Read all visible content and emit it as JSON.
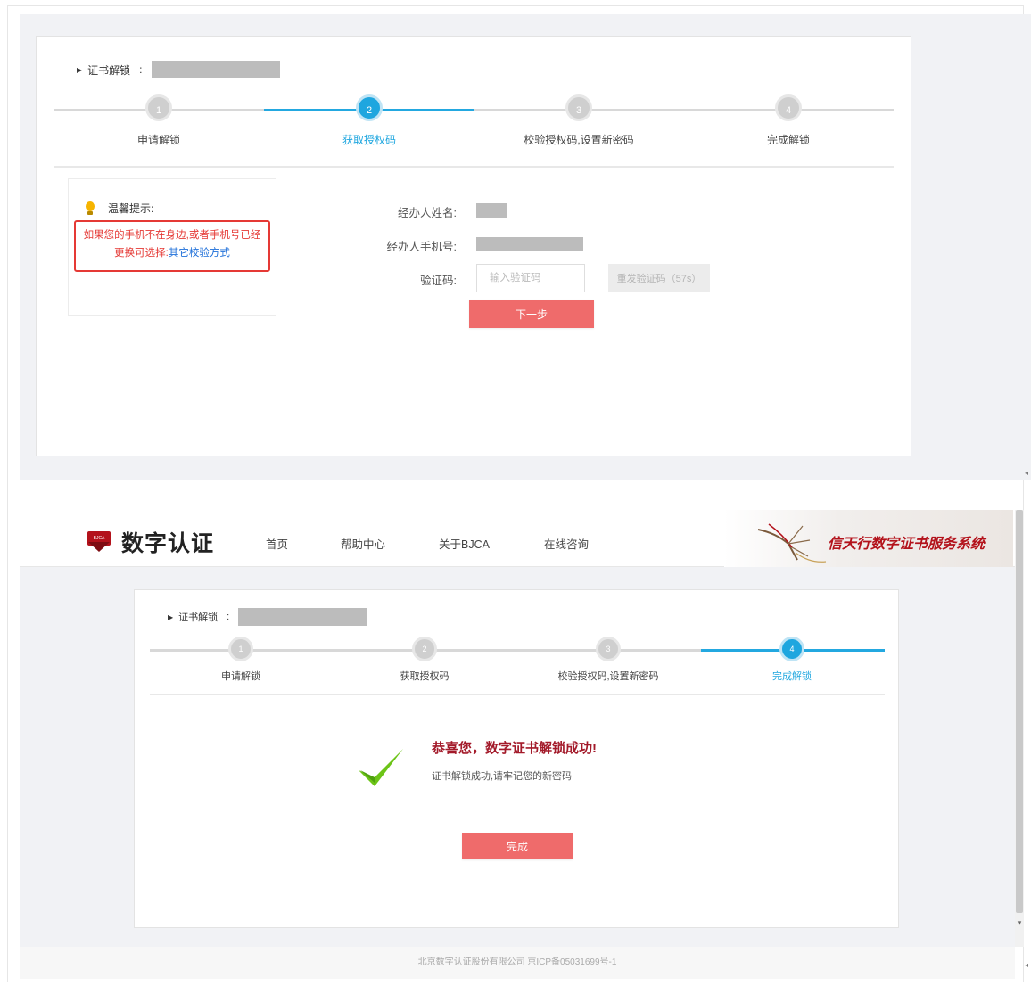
{
  "top": {
    "crumb_label": "证书解锁",
    "crumb_colon": ":",
    "steps": [
      {
        "num": "1",
        "label": "申请解锁"
      },
      {
        "num": "2",
        "label": "获取授权码"
      },
      {
        "num": "3",
        "label": "校验授权码,设置新密码"
      },
      {
        "num": "4",
        "label": "完成解锁"
      }
    ],
    "active_step": 2,
    "tip_title": "温馨提示:",
    "tip_text": "如果您的手机不在身边,或者手机号已经更换可选择:",
    "tip_link": "其它校验方式",
    "name_label": "经办人姓名:",
    "phone_label": "经办人手机号:",
    "code_label": "验证码:",
    "code_placeholder": "输入验证码",
    "resend_label": "重发验证码（57s）",
    "next_label": "下一步"
  },
  "header": {
    "logo_text": "数字认证",
    "logo_badge": "BJCA",
    "nav": [
      "首页",
      "帮助中心",
      "关于BJCA",
      "在线咨询"
    ],
    "banner_text": "信天行数字证书服务系统"
  },
  "bottom": {
    "crumb_label": "证书解锁",
    "crumb_colon": ":",
    "steps": [
      {
        "num": "1",
        "label": "申请解锁"
      },
      {
        "num": "2",
        "label": "获取授权码"
      },
      {
        "num": "3",
        "label": "校验授权码,设置新密码"
      },
      {
        "num": "4",
        "label": "完成解锁"
      }
    ],
    "active_step": 4,
    "success_title": "恭喜您，数字证书解锁成功!",
    "success_sub": "证书解锁成功,请牢记您的新密码",
    "done_label": "完成"
  },
  "footer": {
    "text": "北京数字认证股份有限公司 京ICP备05031699号-1"
  },
  "colors": {
    "accent": "#1ea6df",
    "primary_button": "#ef6b6b",
    "warning": "#e53935",
    "success": "#6cc417"
  }
}
